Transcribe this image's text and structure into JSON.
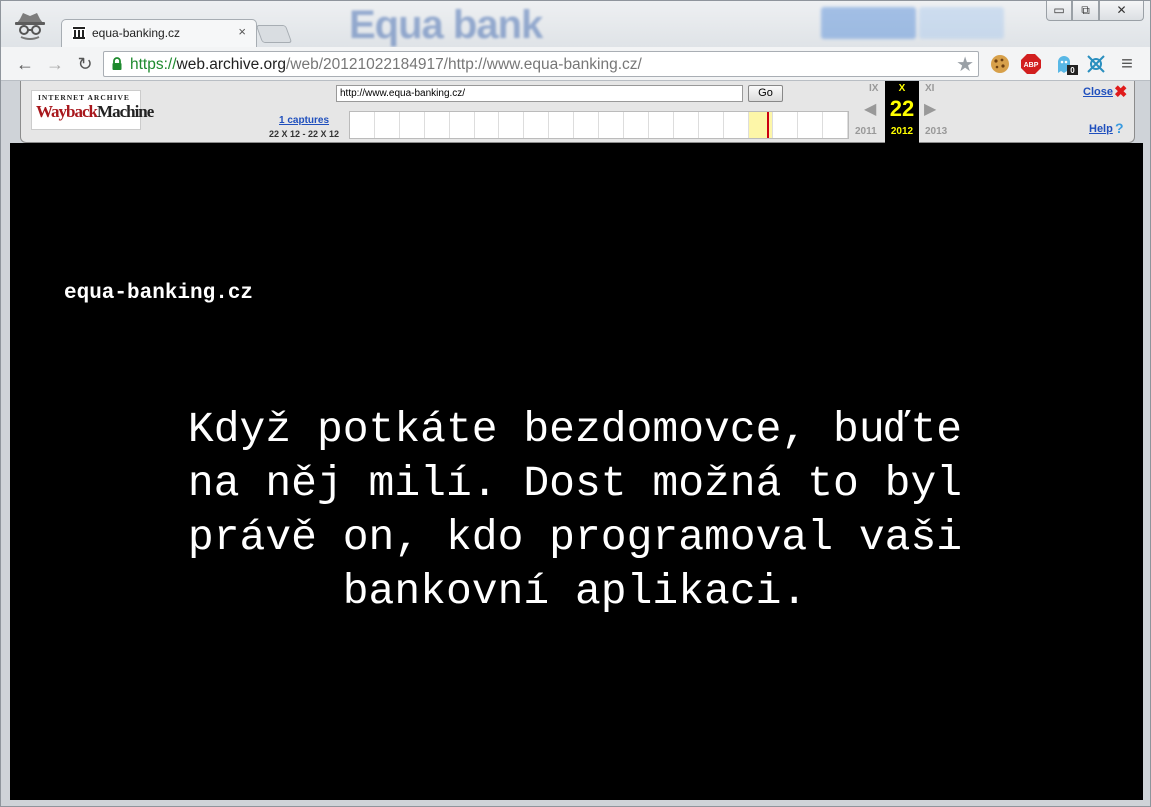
{
  "browser": {
    "tab": {
      "title": "equa-banking.cz",
      "close": "×"
    },
    "window_controls": {
      "minimize": "▭",
      "maximize": "⧉",
      "close": "✕"
    },
    "background_logo": "Equa bank",
    "url": {
      "scheme": "https://",
      "host": "web.archive.org",
      "path": "/web/20121022184917/http://www.equa-banking.cz/"
    },
    "icons": [
      "incognito-icon",
      "back-icon",
      "forward-icon",
      "reload-icon",
      "lock-icon",
      "star-icon",
      "cookie-icon",
      "adblock-icon",
      "ghostery-icon",
      "extension-icon",
      "menu-icon"
    ],
    "nav": {
      "back": "←",
      "forward": "→",
      "reload": "↻",
      "menu": "≡",
      "star": "★"
    },
    "ext_badges": {
      "adblock": "ABP",
      "ghostery_count": "0"
    }
  },
  "wayback": {
    "logo_top": "INTERNET ARCHIVE",
    "logo_main_a": "Wayback",
    "logo_main_b": "Machine",
    "url_value": "http://www.equa-banking.cz/",
    "go_label": "Go",
    "captures_link": "1 captures",
    "captures_range": "22 X 12 - 22 X 12",
    "prev_month": "IX",
    "current_month": "X",
    "next_month": "XI",
    "current_day": "22",
    "prev_year": "2011",
    "current_year": "2012",
    "next_year": "2013",
    "close_label": "Close",
    "help_label": "Help",
    "colors": {
      "link": "#1f4fbd",
      "current_bg": "#000000",
      "current_fg": "#ffff00",
      "close_x": "#e01b1b"
    }
  },
  "page": {
    "site_name": "equa-banking.cz",
    "message": "Když potkáte bezdomovce, buďte na něj milí. Dost možná to byl právě on, kdo programoval vaši bankovní aplikaci.",
    "colors": {
      "background": "#000000",
      "text": "#ffffff"
    }
  }
}
